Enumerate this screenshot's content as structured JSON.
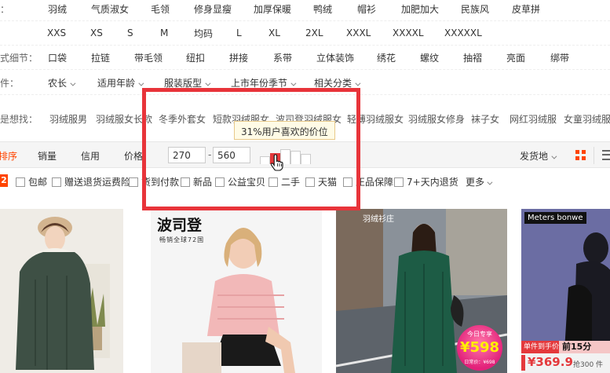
{
  "rows": {
    "style": {
      "label": "点：",
      "options": [
        "羽绒",
        "气质淑女",
        "毛领",
        "修身显瘦",
        "加厚保暖",
        "鸭绒",
        "帽衫",
        "加肥加大",
        "民族风",
        "皮草拼"
      ]
    },
    "size": {
      "options": [
        "XXS",
        "XS",
        "S",
        "M",
        "均码",
        "L",
        "XL",
        "2XL",
        "XXXL",
        "XXXXL",
        "XXXXXL"
      ]
    },
    "detail": {
      "label": "款式细节：",
      "options": [
        "口袋",
        "拉链",
        "带毛领",
        "纽扣",
        "拼接",
        "系带",
        "立体装饰",
        "绣花",
        "螺纹",
        "抽褶",
        "亮面",
        "绑带"
      ]
    },
    "filters": {
      "label": "条件：",
      "options": [
        "农长",
        "适用年龄",
        "服装版型",
        "上市年份季节",
        "相关分类"
      ]
    },
    "tags": {
      "label": "不是想找：",
      "options": [
        "羽绒服男",
        "羽绒服女长款",
        "冬季外套女",
        "短款羽绒服女",
        "波司登羽绒服女",
        "轻薄羽绒服女",
        "羽绒服女修身",
        "袜子女",
        "网红羽绒服",
        "女童羽绒服"
      ]
    }
  },
  "sortbar": {
    "active": "排序",
    "sales": "销量",
    "credit": "信用",
    "price": "价格",
    "price_min": "270",
    "price_sep": "-",
    "price_max": "560",
    "tooltip": "31%用户喜欢的价位",
    "price_histogram": [
      0.45,
      0.65,
      0.85,
      0.75,
      0.6
    ],
    "ship_from": "发货地"
  },
  "checkboxes": {
    "badge": "2",
    "items": [
      "包邮",
      "赠送退货运费险",
      "货到付款",
      "新品",
      "公益宝贝",
      "二手",
      "天猫",
      "正品保障",
      "7+天内退货"
    ],
    "more": "更多"
  },
  "products": {
    "p2_brand": "波司登",
    "p2_sub": "畅销全球72国",
    "p3_brand": "羽绒衫庄",
    "p3_promo_top": "今日专享",
    "p3_promo_price": "¥598",
    "p3_promo_bottom": "日常价：¥698",
    "p4_brand": "Meters bonwe",
    "p4_tag": "单件到手价",
    "p4_tag2": "前15分",
    "p4_price": "¥369.9",
    "p4_price_sub": "抢300 件"
  },
  "colors": {
    "accent": "#ff4400",
    "highlight": "#e8343a",
    "hist_selected": "#e4393c"
  }
}
